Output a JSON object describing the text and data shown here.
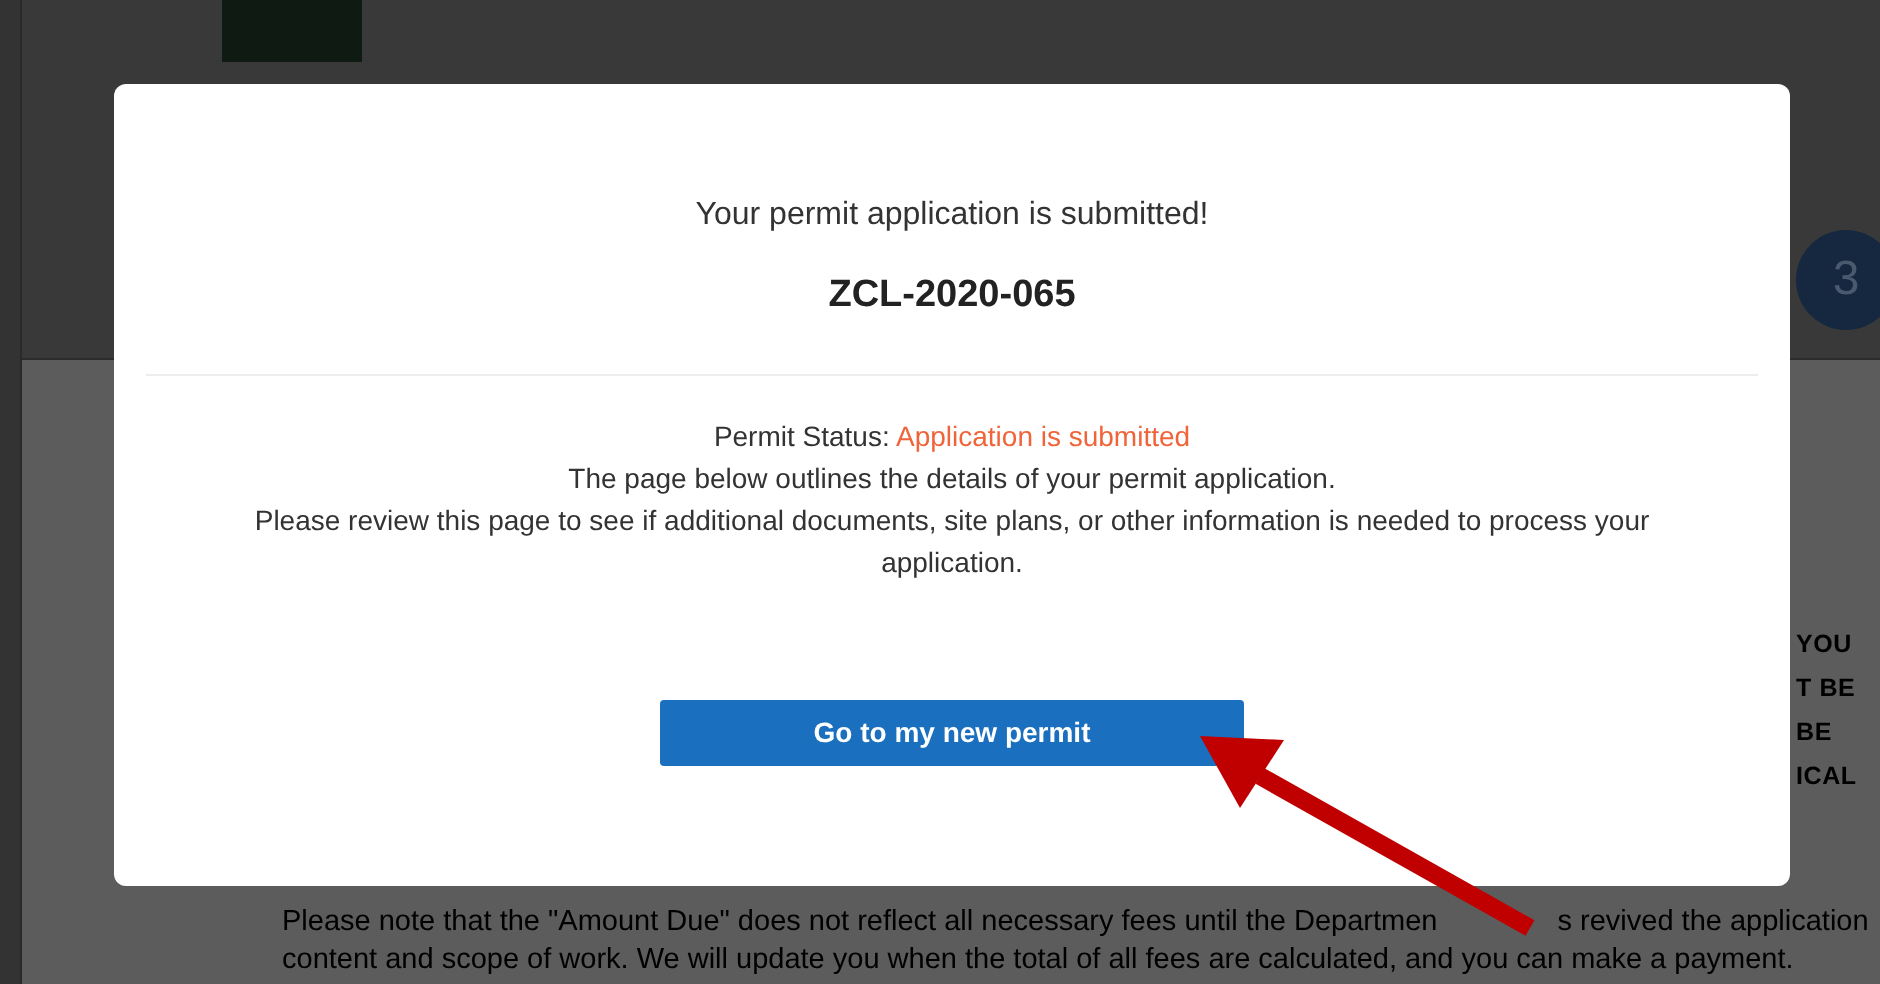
{
  "page": {
    "step_number": "3",
    "side_texts": [
      "YOU",
      "T BE",
      "BE",
      "ICAL"
    ],
    "notice": [
      [
        "Please note that the \"Amount Due\" does not reflect all necessary fees until the Departmen",
        "s revived the application"
      ],
      [
        "content and scope of work.  We will update you when the total of all fees are calculated, and you can make a payment."
      ]
    ]
  },
  "modal": {
    "heading": "Your permit application is submitted!",
    "permit_id": "ZCL-2020-065",
    "status_label": "Permit Status:",
    "status_value": "Application is submitted",
    "lines": [
      "The page below outlines the details of your permit application.",
      "Please review this page to see if additional documents, site plans, or other information is needed to process your application."
    ],
    "button": "Go to my new permit"
  }
}
